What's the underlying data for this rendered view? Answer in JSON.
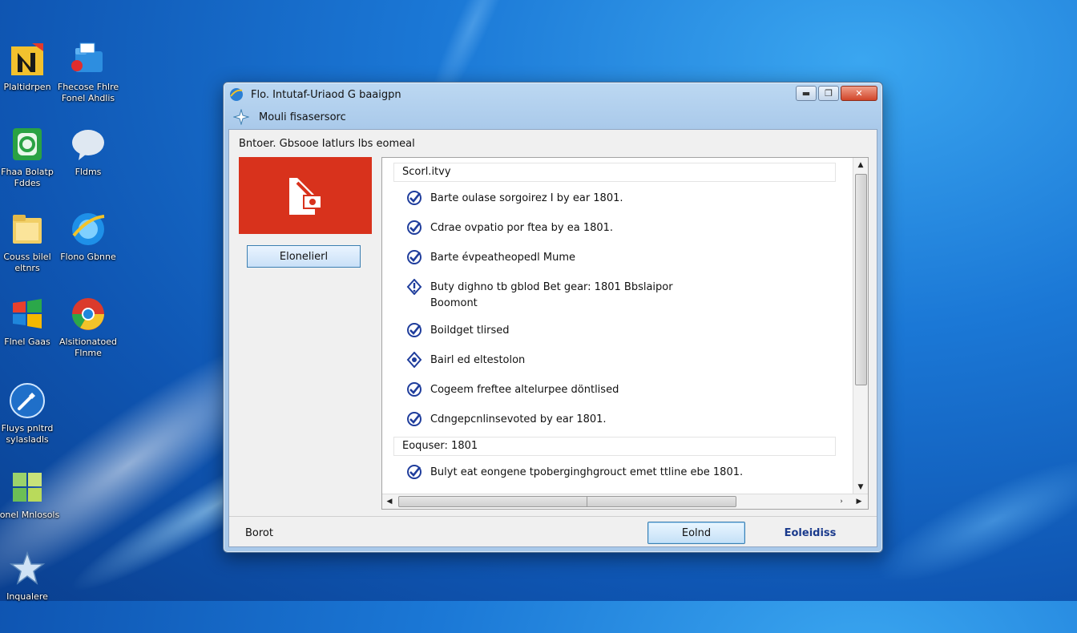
{
  "desktop": {
    "icons": [
      {
        "label": "Plaltidrpen",
        "icon": "n-logo-icon"
      },
      {
        "label": "Fhecose Fhlre Fonel Ahdlis",
        "icon": "folder-network-icon"
      },
      {
        "label": "Fhaa Bolatp Fddes",
        "icon": "green-app-icon"
      },
      {
        "label": "Fldms",
        "icon": "chat-bubble-icon"
      },
      {
        "label": "Couss bilel eltnrs",
        "icon": "folder-icon"
      },
      {
        "label": "Flono Gbnne",
        "icon": "internet-explorer-icon"
      },
      {
        "label": "Flnel Gaas",
        "icon": "windows-flag-icon"
      },
      {
        "label": "Alsitionatoed Flnme",
        "icon": "chrome-icon"
      },
      {
        "label": "Fluys pnltrd sylasladls",
        "icon": "tools-icon"
      },
      {
        "label": "Fonel Mnlosols",
        "icon": "tiles-icon"
      },
      {
        "label": "Inqualere",
        "icon": "star-icon"
      }
    ]
  },
  "window": {
    "title": "Flo. Intutaf-Uriaod G baaigpn",
    "subtitle": "Mouli fisasersorc",
    "controls": {
      "minimize": "▬",
      "restore": "❐",
      "close": "✕"
    },
    "heading": "Bntoer.  Gbsooe Iatlurs lbs eomeal",
    "hero_button": "Elonelierl",
    "sections": [
      {
        "header": "Scorl.itvy",
        "items": [
          {
            "text": "Barte oulase sorgoirez I by ear 1801.",
            "icon": "check-circle-icon"
          },
          {
            "text": "Cdrae ovpatio por ftea by ea 1801.",
            "icon": "check-circle-icon"
          },
          {
            "text": "Barte évpeatheopedl Mume",
            "icon": "check-circle-icon"
          },
          {
            "text": "Buty dighno tb gblod Bet gear: 1801 Bbslaipor Boomont",
            "icon": "warning-shield-icon"
          },
          {
            "text": "Boildget tlirsed",
            "icon": "check-circle-icon"
          },
          {
            "text": "Bairl ed eltestolon",
            "icon": "info-circle-icon"
          },
          {
            "text": "Cogeem freftee altelurpee döntlised",
            "icon": "check-circle-icon"
          },
          {
            "text": "Cdngepcnlinsevoted by ear 1801.",
            "icon": "check-circle-icon"
          }
        ]
      },
      {
        "header": "Eoquser: 1801",
        "items": [
          {
            "text": "Bulyt eat eongene tpoberginghgrouct emet ttline ebe 1801.",
            "icon": "check-circle-icon"
          }
        ]
      }
    ],
    "footer": {
      "left_label": "Borot",
      "primary_button": "Eolnd",
      "link_button": "Eoleidiss"
    }
  },
  "colors": {
    "hero_red": "#d8321c",
    "check_blue": "#1f3d9c",
    "close_red": "#d1452a",
    "desktop_blue": "#1b78d6"
  }
}
